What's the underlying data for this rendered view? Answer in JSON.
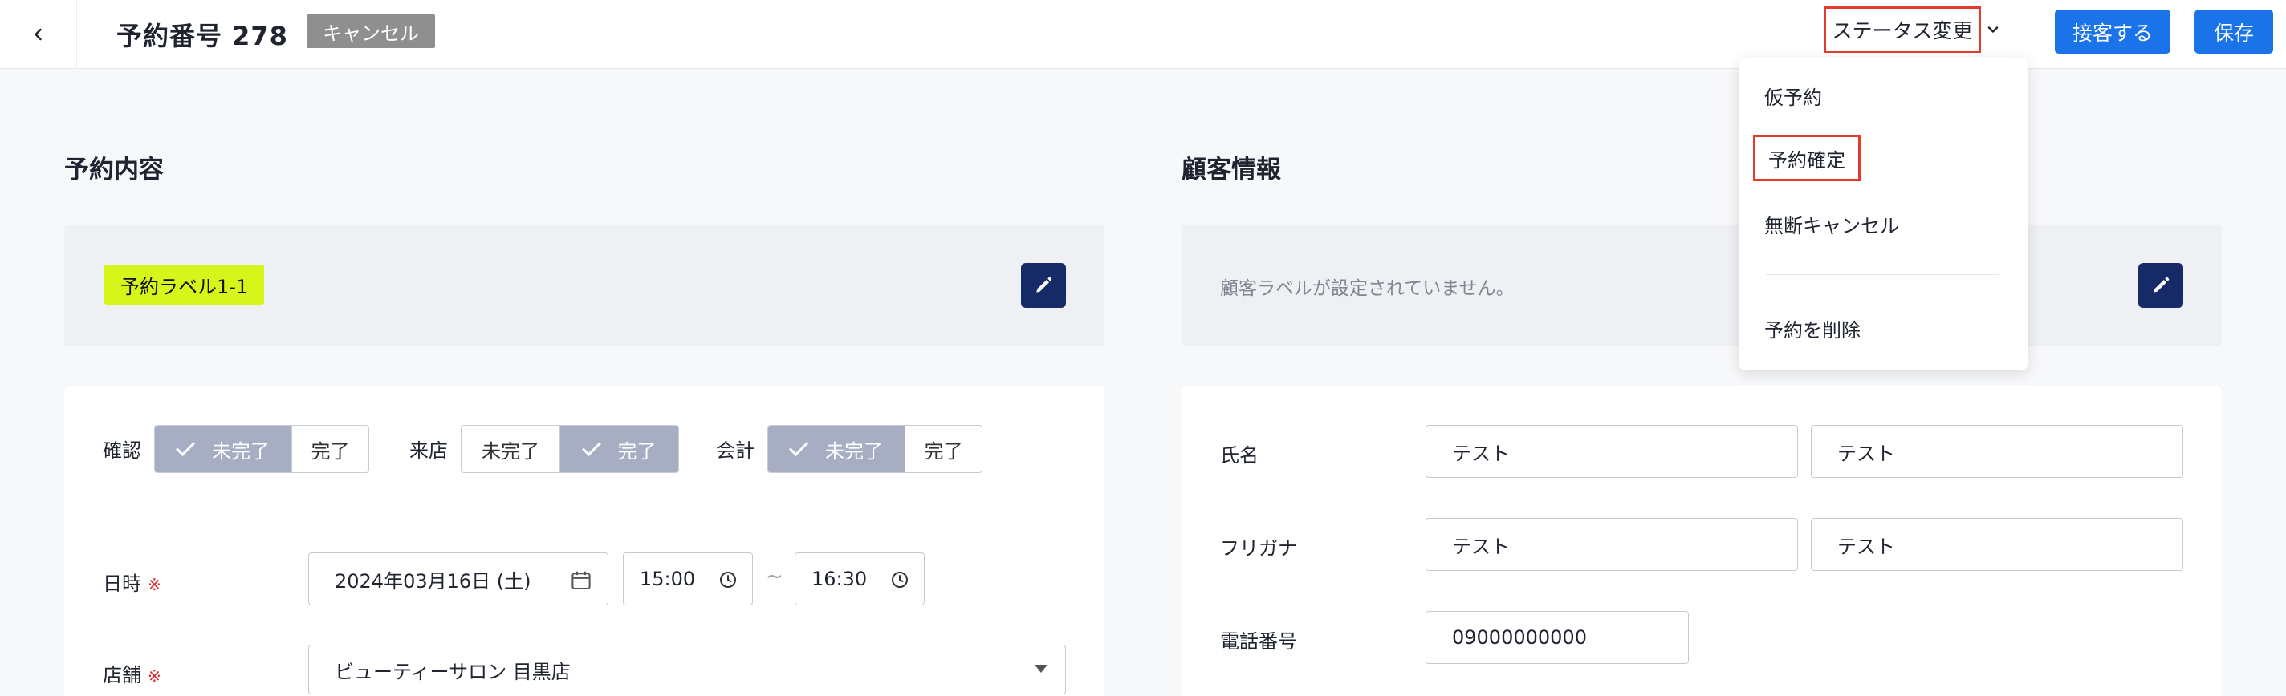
{
  "header": {
    "title": "予約番号 278",
    "status_badge": "キャンセル",
    "status_change_label": "ステータス変更",
    "reception_label": "接客する",
    "save_label": "保存"
  },
  "dropdown": {
    "items": [
      "仮予約",
      "予約確定",
      "無断キャンセル",
      "予約を削除"
    ]
  },
  "reservation": {
    "section_title": "予約内容",
    "label_tag": "予約ラベル1-1",
    "toggles": [
      {
        "label": "確認",
        "options": [
          "未完了",
          "完了"
        ],
        "selected": "未完了"
      },
      {
        "label": "来店",
        "options": [
          "未完了",
          "完了"
        ],
        "selected": "完了"
      },
      {
        "label": "会計",
        "options": [
          "未完了",
          "完了"
        ],
        "selected": "未完了"
      }
    ],
    "datetime_label": "日時",
    "required_mark": "※",
    "date_value": "2024年03月16日 (土)",
    "start_time": "15:00",
    "tilde": "~",
    "end_time": "16:30",
    "store_label": "店舗",
    "store_value": "ビューティーサロン 目黒店"
  },
  "customer": {
    "section_title": "顧客情報",
    "empty_label_text": "顧客ラベルが設定されていません。",
    "name_label": "氏名",
    "last_name": "テスト",
    "first_name": "テスト",
    "kana_label": "フリガナ",
    "last_kana": "テスト",
    "first_kana": "テスト",
    "phone_label": "電話番号",
    "phone_value": "09000000000"
  },
  "colors": {
    "primary": "#1a73e8",
    "highlight_border": "#e23b2e",
    "label_tag": "#d6f51a",
    "edit_button": "#152a66",
    "toggle_active": "#a7aec4"
  }
}
